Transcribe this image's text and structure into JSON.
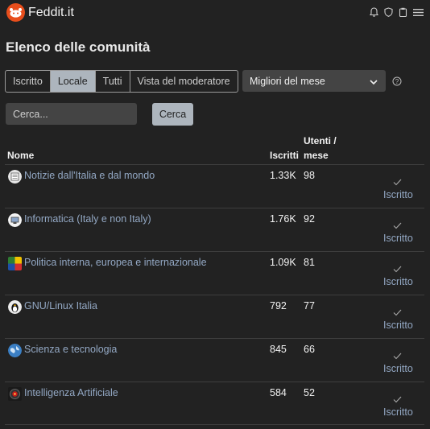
{
  "header": {
    "site_name": "Feddit.it",
    "icons": [
      "bell-icon",
      "shield-icon",
      "clipboard-icon",
      "menu-icon"
    ]
  },
  "page": {
    "title": "Elenco delle comunità"
  },
  "filters": {
    "tabs": [
      {
        "label": "Iscritto",
        "active": false
      },
      {
        "label": "Locale",
        "active": true
      },
      {
        "label": "Tutti",
        "active": false
      },
      {
        "label": "Vista del moderatore",
        "active": false
      }
    ],
    "sort_selected": "Migliori del mese"
  },
  "search": {
    "placeholder": "Cerca...",
    "button_label": "Cerca"
  },
  "table": {
    "headers": {
      "name": "Nome",
      "subscribers": "Iscritti",
      "users_line1": "Utenti /",
      "users_line2": "mese"
    },
    "rows": [
      {
        "name": "Notizie dall'Italia e dal mondo",
        "subscribers": "1.33K",
        "users": "98",
        "status": "Iscritto",
        "icon": "newspaper-icon"
      },
      {
        "name": "Informatica (Italy e non Italy)",
        "subscribers": "1.76K",
        "users": "92",
        "status": "Iscritto",
        "icon": "computer-icon"
      },
      {
        "name": "Politica interna, europea e internazionale",
        "subscribers": "1.09K",
        "users": "81",
        "status": "Iscritto",
        "icon": "flags-icon"
      },
      {
        "name": "GNU/Linux Italia",
        "subscribers": "792",
        "users": "77",
        "status": "Iscritto",
        "icon": "tux-penguin-icon"
      },
      {
        "name": "Scienza e tecnologia",
        "subscribers": "845",
        "users": "66",
        "status": "Iscritto",
        "icon": "globe-icon"
      },
      {
        "name": "Intelligenza Artificiale",
        "subscribers": "584",
        "users": "52",
        "status": "Iscritto",
        "icon": "robot-eye-icon"
      }
    ]
  },
  "colors": {
    "background": "#222222",
    "link": "#93a8c4",
    "logo": "#e84e1c",
    "active_tab": "#adb5bd"
  }
}
